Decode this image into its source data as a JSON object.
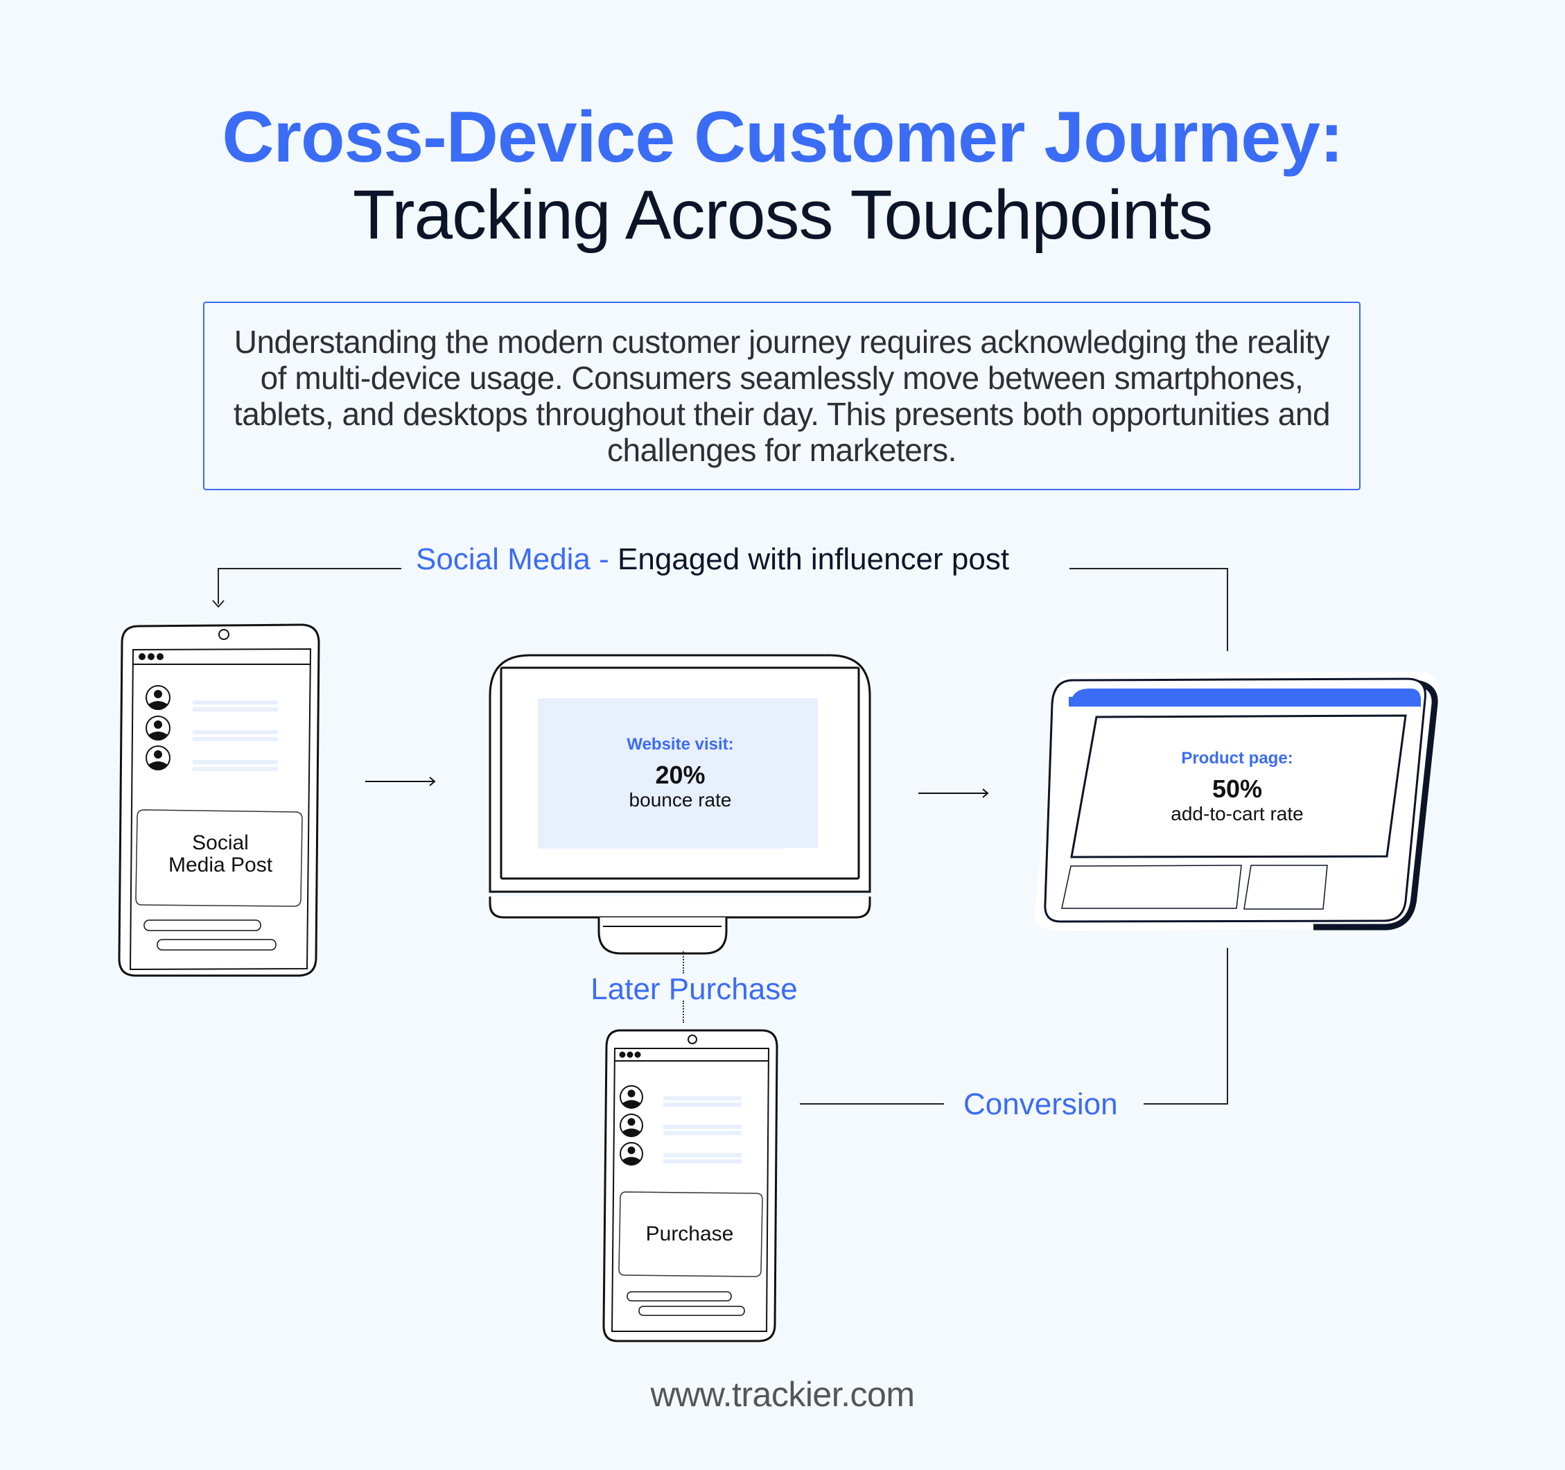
{
  "header": {
    "title_line1": "Cross-Device Customer Journey:",
    "title_line2": "Tracking Across Touchpoints"
  },
  "intro": {
    "text": "Understanding the modern customer journey requires acknowledging the reality of multi-device usage. Consumers seamlessly move between smartphones, tablets, and desktops throughout their day. This presents both opportunities and challenges for marketers."
  },
  "flow": {
    "social_label_channel": "Social Media",
    "social_label_separator": " - ",
    "social_label_action": "Engaged with influencer post",
    "later_purchase_label": "Later Purchase",
    "conversion_label": "Conversion"
  },
  "devices": {
    "phone_social": {
      "post_line1": "Social",
      "post_line2": "Media Post"
    },
    "desktop": {
      "heading": "Website visit:",
      "value": "20%",
      "caption": "bounce rate"
    },
    "tablet": {
      "heading": "Product page:",
      "value": "50%",
      "caption": "add-to-cart rate"
    },
    "phone_purchase": {
      "post_line1": "Purchase"
    }
  },
  "colors": {
    "accent": "#3a6cf6",
    "dark": "#0c1428",
    "background": "#f4f9fe",
    "placeholder": "#e8effd"
  },
  "footer": {
    "url": "www.trackier.com"
  }
}
